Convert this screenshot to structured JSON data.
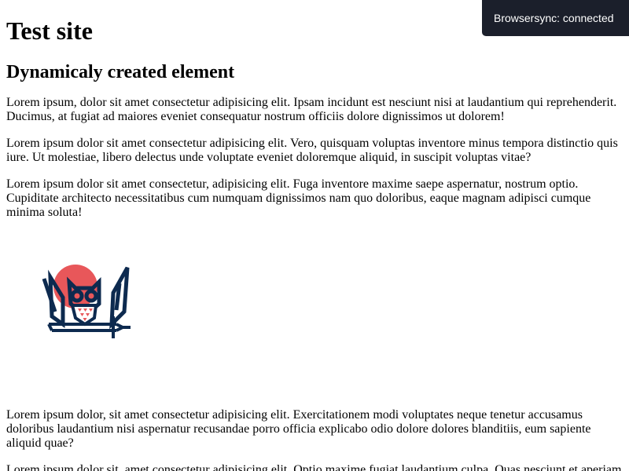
{
  "page": {
    "title": "Test site",
    "subtitle": "Dynamicaly created element"
  },
  "paragraphs": [
    "Lorem ipsum, dolor sit amet consectetur adipisicing elit. Ipsam incidunt est nesciunt nisi at laudantium qui reprehenderit. Ducimus, at fugiat ad maiores eveniet consequatur nostrum officiis dolore dignissimos ut dolorem!",
    "Lorem ipsum dolor sit amet consectetur adipisicing elit. Vero, quisquam voluptas inventore minus tempora distinctio quis iure. Ut molestiae, libero delectus unde voluptate eveniet doloremque aliquid, in suscipit voluptas vitae?",
    "Lorem ipsum dolor sit amet consectetur, adipisicing elit. Fuga inventore maxime saepe aspernatur, nostrum optio. Cupiditate architecto necessitatibus cum numquam dignissimos nam quo doloribus, eaque magnam adipisci cumque minima soluta!",
    "Lorem ipsum dolor, sit amet consectetur adipisicing elit. Exercitationem modi voluptates neque tenetur accusamus doloribus laudantium nisi aspernatur recusandae porro officia explicabo odio dolore dolores blanditiis, eum sapiente aliquid quae?",
    "Lorem ipsum dolor sit, amet consectetur adipisicing elit. Optio maxime fugiat laudantium culpa. Quas nesciunt et aperiam"
  ],
  "logo": {
    "icon": "owl-sword-icon",
    "colors": {
      "navy": "#0d2a4f",
      "sun": "#e8575a"
    }
  },
  "browsersync": {
    "label": "Browsersync: connected",
    "background": "#1b1f2b"
  }
}
